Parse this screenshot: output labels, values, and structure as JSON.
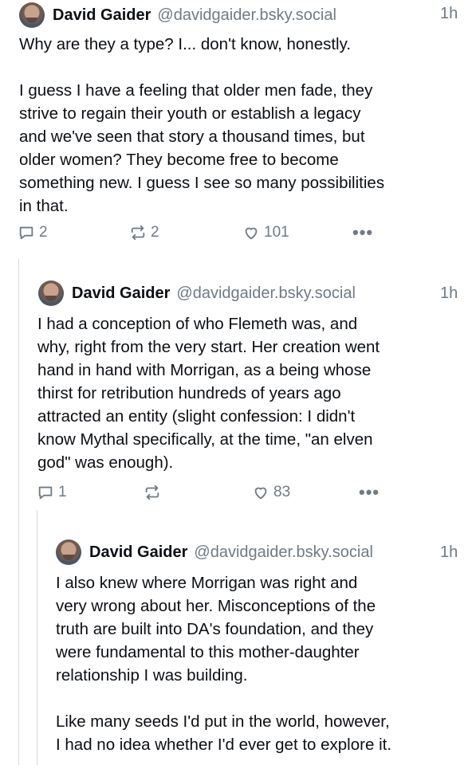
{
  "posts": [
    {
      "author": "David Gaider",
      "handle": "@davidgaider.bsky.social",
      "time": "1h",
      "text": "Why are they a type? I... don't know, honestly.\n\nI guess I have a feeling that older men fade, they\nstrive to regain their youth or establish a legacy\nand we've seen that story a thousand times, but\nolder women? They become free to become\nsomething new. I guess I see so many possibilities\nin that.",
      "replies": "2",
      "reposts": "2",
      "likes": "101",
      "more": "•••"
    },
    {
      "author": "David Gaider",
      "handle": "@davidgaider.bsky.social",
      "time": "1h",
      "text": "I had a conception of who Flemeth was, and\nwhy, right from the very start. Her creation went\nhand in hand with Morrigan, as a being whose\nthirst for retribution hundreds of years ago\nattracted an entity (slight confession: I didn't\nknow Mythal specifically, at the time, \"an elven\ngod\" was enough).",
      "replies": "1",
      "reposts": "",
      "likes": "83",
      "more": "•••"
    },
    {
      "author": "David Gaider",
      "handle": "@davidgaider.bsky.social",
      "time": "1h",
      "text": "I also knew where Morrigan was right and\nvery wrong about her. Misconceptions of the\ntruth are built into DA's foundation, and they\nwere fundamental to this mother-daughter\nrelationship I was building.\n\nLike many seeds I'd put in the world, however,\nI had no idea whether I'd ever get to explore it."
    }
  ]
}
